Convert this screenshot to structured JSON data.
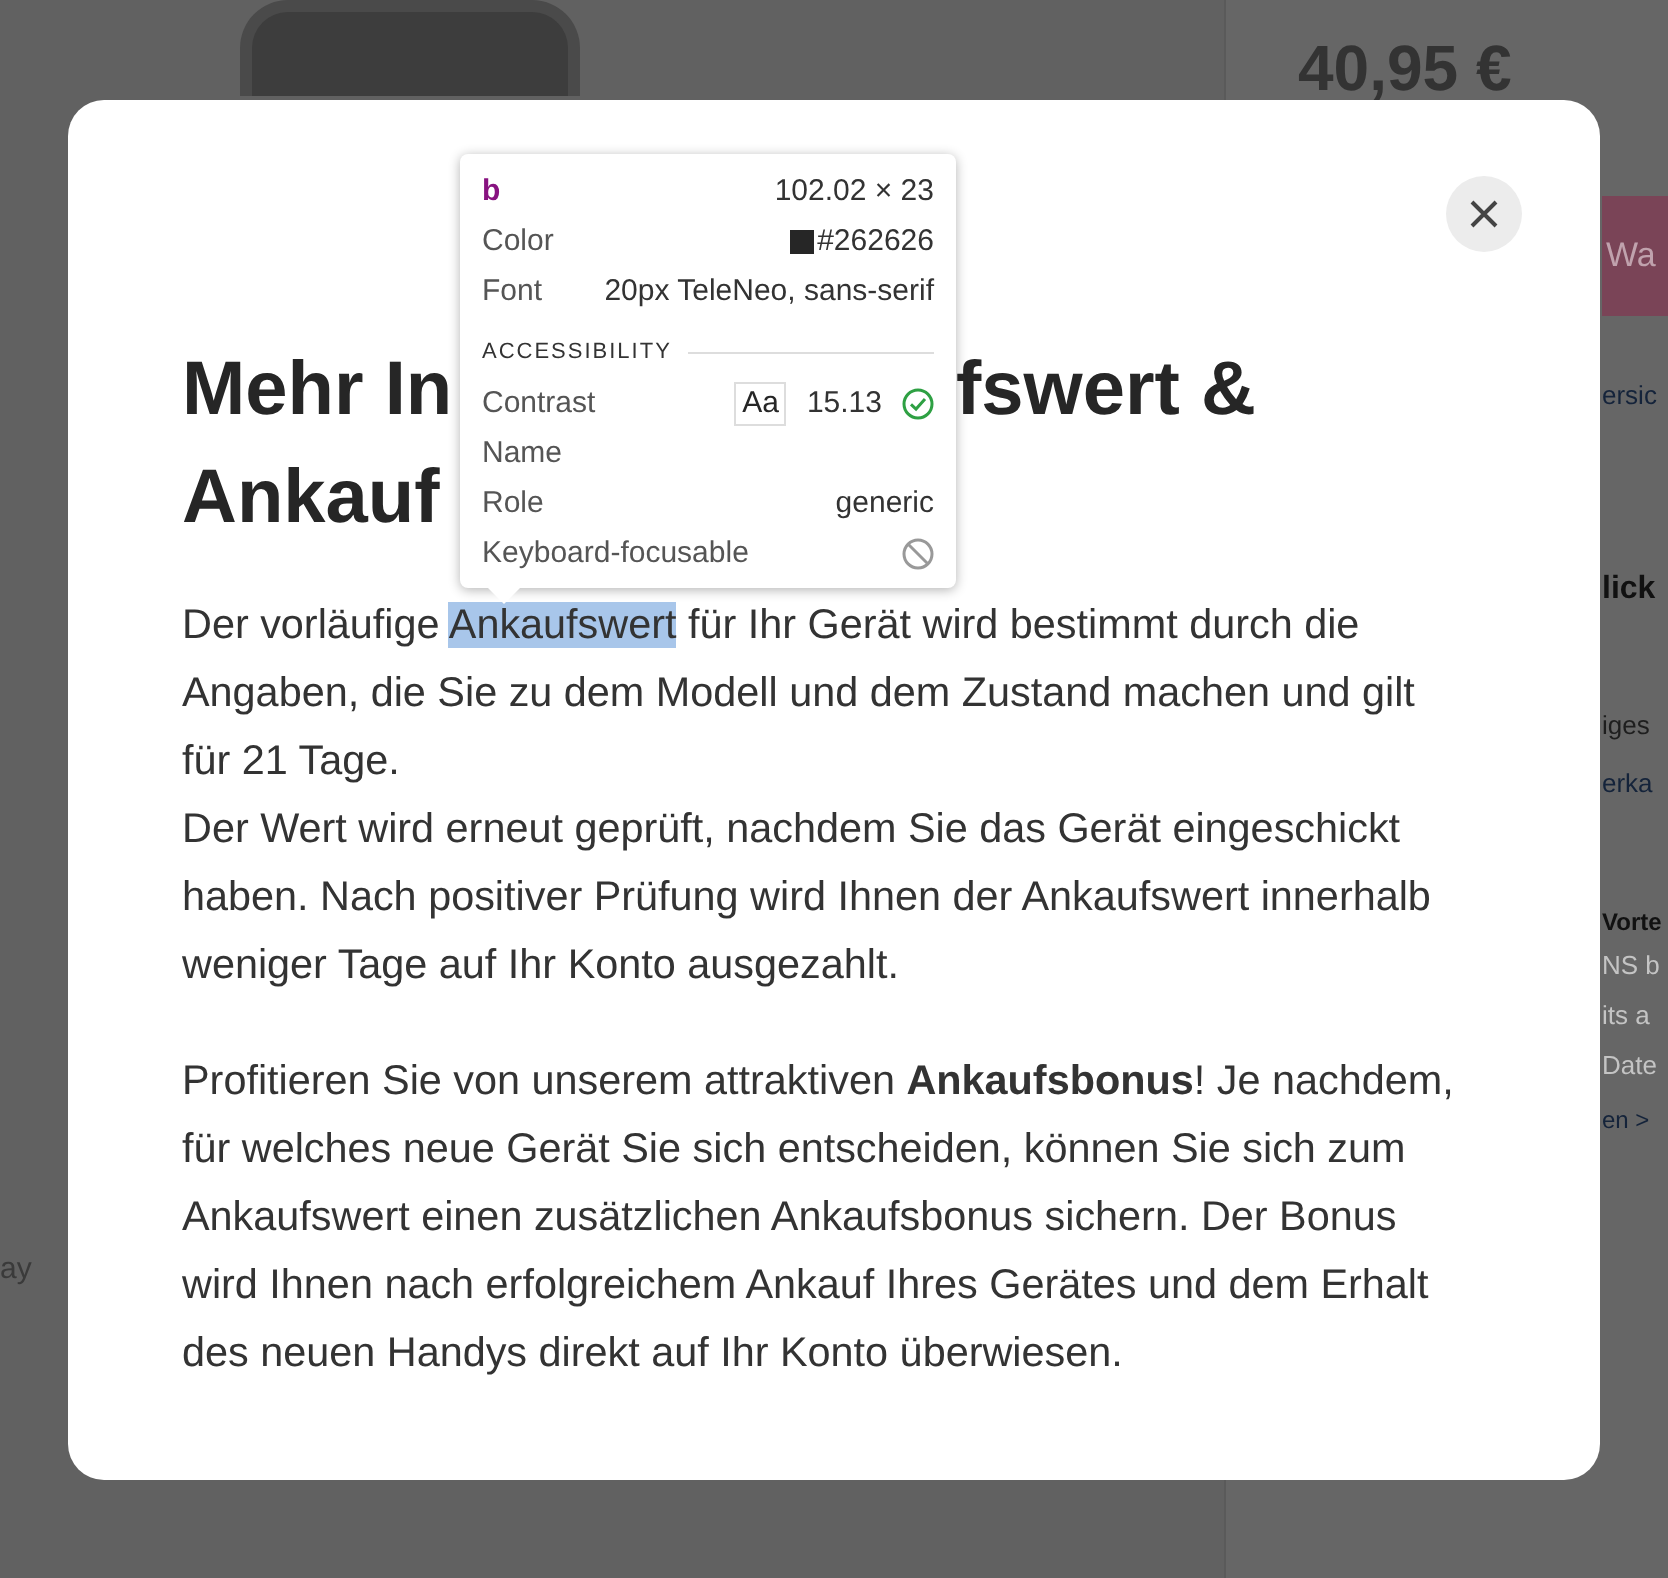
{
  "background": {
    "price": "40,95 €",
    "button_text": "Wa",
    "link_1": "ersic",
    "heading_1": "lick",
    "text_1": "iges",
    "link_2": "erka",
    "heading_2": "Vorte",
    "text_lines": [
      "NS b",
      "its a",
      "Date"
    ],
    "link_3": "en >",
    "left_text": "ay"
  },
  "modal": {
    "title_line_1_start": "Mehr In",
    "title_line_1_end": "fswert &",
    "title_line_2": "Ankauf",
    "paragraph_1": {
      "before": "Der vorläufige ",
      "highlighted": "Ankaufswert",
      "after": " für Ihr Gerät wird bestimmt durch die Angaben, die Sie zu dem Modell und dem Zustand machen und gilt für 21 Tage."
    },
    "paragraph_2": "Der Wert wird erneut geprüft, nachdem Sie das Gerät eingeschickt haben. Nach positiver Prüfung wird Ihnen der Ankaufswert innerhalb weniger Tage auf Ihr Konto ausgezahlt.",
    "paragraph_3": "Profitieren Sie von unserem attraktiven **Ankaufsbonus**! Je nachdem, für welches neue Gerät Sie sich entscheiden, können Sie sich zum Ankaufswert einen zusätzlichen Ankaufsbonus sichern. Der Bonus wird Ihnen nach erfolgreichem Ankauf Ihres Gerätes und dem Erhalt des neuen Handys direkt auf Ihr Konto überwiesen."
  },
  "inspector_tooltip": {
    "tag": "b",
    "size": "102.02 × 23",
    "color_label": "Color",
    "color_value": "#262626",
    "font_label": "Font",
    "font_value": "20px TeleNeo, sans-serif",
    "section": "ACCESSIBILITY",
    "contrast_label": "Contrast",
    "contrast_sample": "Aa",
    "contrast_value": "15.13",
    "contrast_pass": true,
    "name_label": "Name",
    "role_label": "Role",
    "role_value": "generic",
    "focusable_label": "Keyboard-focusable",
    "focusable": false
  }
}
